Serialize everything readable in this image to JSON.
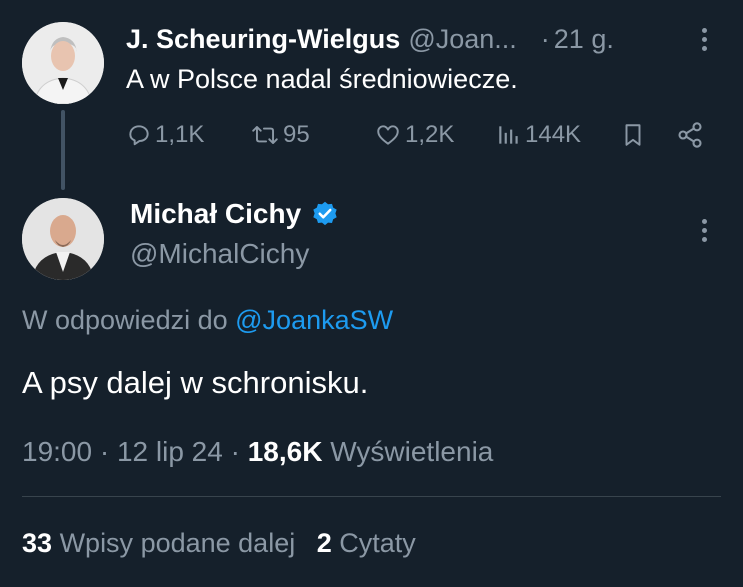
{
  "parent_tweet": {
    "display_name": "J. Scheuring-Wielgus",
    "handle": "@Joan...",
    "separator": "·",
    "time_ago": "21 g.",
    "text": "A w Polsce nadal średniowiecze.",
    "replies": "1,1K",
    "retweets": "95",
    "likes": "1,2K",
    "views": "144K"
  },
  "main_tweet": {
    "display_name": "Michał Cichy",
    "handle": "@MichalCichy",
    "verified": true,
    "reply_prefix": "W odpowiedzi do",
    "reply_mention": "@JoankaSW",
    "text": "A psy dalej w schronisku.",
    "time": "19:00",
    "sep1": "·",
    "date": "12 lip 24",
    "sep2": "·",
    "views_count": "18,6K",
    "views_label": "Wyświetlenia",
    "reposts_count": "33",
    "reposts_label": "Wpisy podane dalej",
    "quotes_count": "2",
    "quotes_label": "Cytaty"
  },
  "colors": {
    "background": "#15202b",
    "secondary_text": "#8b98a5",
    "accent": "#1d9bf0",
    "divider": "#38444d"
  },
  "icons": [
    "reply-icon",
    "retweet-icon",
    "like-icon",
    "views-icon",
    "bookmark-icon",
    "share-icon",
    "verified-badge-icon",
    "more-icon"
  ]
}
